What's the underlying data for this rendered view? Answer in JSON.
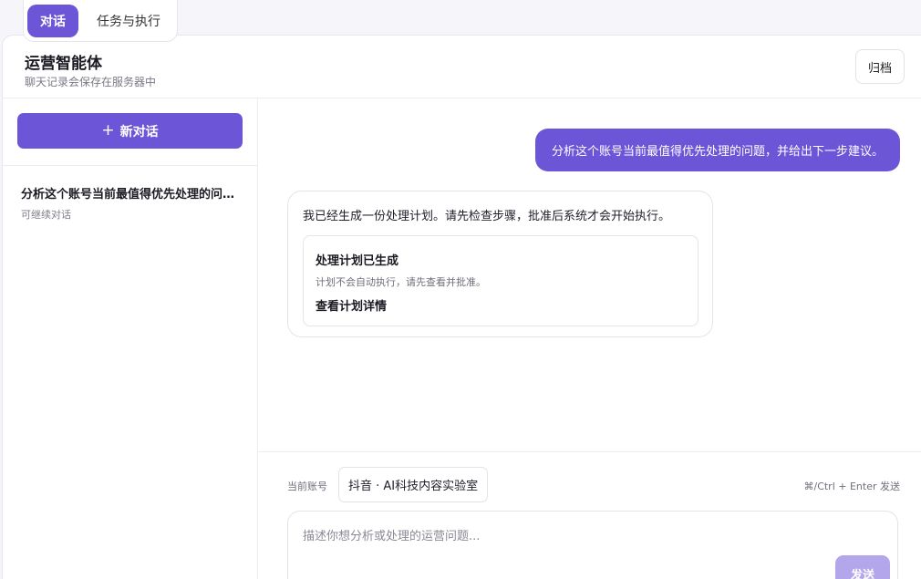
{
  "tabs": [
    {
      "label": "对话",
      "active": true
    },
    {
      "label": "任务与执行",
      "active": false
    }
  ],
  "header": {
    "title": "运营智能体",
    "subtitle": "聊天记录会保存在服务器中",
    "archive_label": "归档"
  },
  "sidebar": {
    "new_chat_icon": "+",
    "new_chat_label": "新对话",
    "conversations": [
      {
        "title": "分析这个账号当前最值得优先处理的问题，并给出下一步建议。",
        "status": "可继续对话"
      }
    ]
  },
  "messages": {
    "user": "分析这个账号当前最值得优先处理的问题，并给出下一步建议。",
    "assistant": "我已经生成一份处理计划。请先检查步骤，批准后系统才会开始执行。",
    "plan_card": {
      "title": "处理计划已生成",
      "description": "计划不会自动执行，请先查看并批准。",
      "link": "查看计划详情"
    }
  },
  "composer": {
    "account_label": "当前账号",
    "account_value": "抖音 · AI科技内容实验室",
    "shortcut": "⌘/Ctrl + Enter 发送",
    "placeholder": "描述你想分析或处理的运营问题...",
    "send_label": "发送"
  },
  "colors": {
    "accent": "#6c55d6",
    "send_disabled": "#b3a6ea"
  }
}
